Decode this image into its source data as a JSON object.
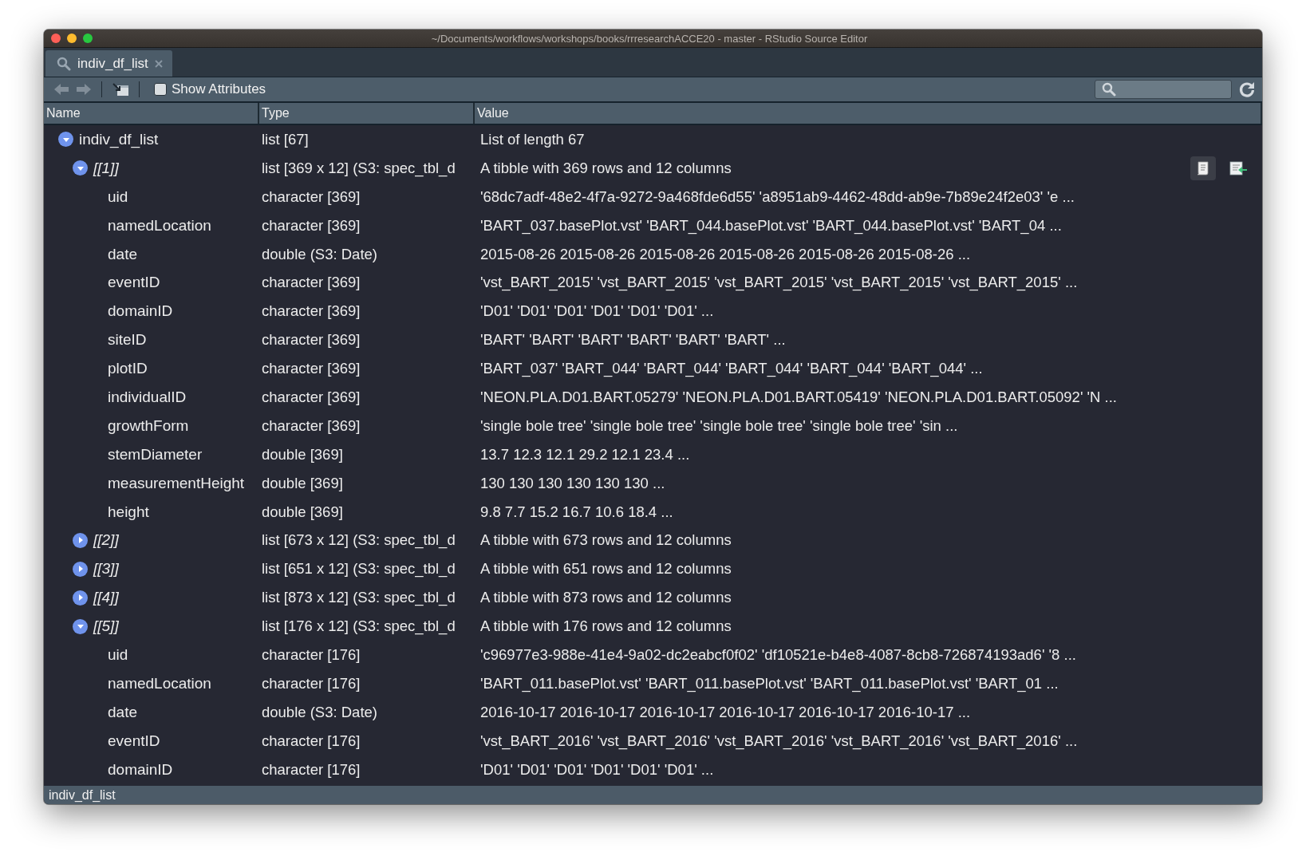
{
  "window": {
    "title": "~/Documents/workflows/workshops/books/rrresearchACCE20 - master - RStudio Source Editor"
  },
  "tabs": [
    {
      "label": "indiv_df_list",
      "selected": true
    }
  ],
  "toolbar": {
    "back_disabled": true,
    "forward_disabled": true,
    "show_attributes": {
      "label": "Show Attributes",
      "checked": false
    }
  },
  "columns": [
    "Name",
    "Type",
    "Value"
  ],
  "tree": [
    {
      "kind": "list",
      "name": "indiv_df_list",
      "type": "list [67]",
      "value": "List of length 67",
      "expanded": true,
      "hovered": false,
      "children": [
        {
          "kind": "element",
          "name": "[[1]]",
          "type": "list [369 x 12] (S3: spec_tbl_d",
          "value": "A tibble with 369 rows and 12 columns",
          "expanded": true,
          "hovered": true,
          "children": [
            {
              "kind": "column",
              "name": "uid",
              "type": "character [369]",
              "value": "'68dc7adf-48e2-4f7a-9272-9a468fde6d55' 'a8951ab9-4462-48dd-ab9e-7b89e24f2e03' 'e ...",
              "hovered": false
            },
            {
              "kind": "column",
              "name": "namedLocation",
              "type": "character [369]",
              "value": "'BART_037.basePlot.vst' 'BART_044.basePlot.vst' 'BART_044.basePlot.vst' 'BART_04 ...",
              "hovered": false
            },
            {
              "kind": "column",
              "name": "date",
              "type": "double (S3: Date)",
              "value": "2015-08-26 2015-08-26 2015-08-26 2015-08-26 2015-08-26 2015-08-26 ...",
              "hovered": false
            },
            {
              "kind": "column",
              "name": "eventID",
              "type": "character [369]",
              "value": "'vst_BART_2015' 'vst_BART_2015' 'vst_BART_2015' 'vst_BART_2015' 'vst_BART_2015' ...",
              "hovered": false
            },
            {
              "kind": "column",
              "name": "domainID",
              "type": "character [369]",
              "value": "'D01' 'D01' 'D01' 'D01' 'D01' 'D01' ...",
              "hovered": false
            },
            {
              "kind": "column",
              "name": "siteID",
              "type": "character [369]",
              "value": "'BART' 'BART' 'BART' 'BART' 'BART' 'BART' ...",
              "hovered": false
            },
            {
              "kind": "column",
              "name": "plotID",
              "type": "character [369]",
              "value": "'BART_037' 'BART_044' 'BART_044' 'BART_044' 'BART_044' 'BART_044' ...",
              "hovered": false
            },
            {
              "kind": "column",
              "name": "individualID",
              "type": "character [369]",
              "value": "'NEON.PLA.D01.BART.05279' 'NEON.PLA.D01.BART.05419' 'NEON.PLA.D01.BART.05092' 'N ...",
              "hovered": false
            },
            {
              "kind": "column",
              "name": "growthForm",
              "type": "character [369]",
              "value": "'single bole tree' 'single bole tree' 'single bole tree' 'single bole tree' 'sin ...",
              "hovered": false
            },
            {
              "kind": "column",
              "name": "stemDiameter",
              "type": "double [369]",
              "value": "13.7 12.3 12.1 29.2 12.1 23.4 ...",
              "hovered": false
            },
            {
              "kind": "column",
              "name": "measurementHeight",
              "type": "double [369]",
              "value": "130 130 130 130 130 130 ...",
              "hovered": false
            },
            {
              "kind": "column",
              "name": "height",
              "type": "double [369]",
              "value": "9.8 7.7 15.2 16.7 10.6 18.4 ...",
              "hovered": false
            }
          ]
        },
        {
          "kind": "element",
          "name": "[[2]]",
          "type": "list [673 x 12] (S3: spec_tbl_d",
          "value": "A tibble with 673 rows and 12 columns",
          "expanded": false,
          "hovered": false
        },
        {
          "kind": "element",
          "name": "[[3]]",
          "type": "list [651 x 12] (S3: spec_tbl_d",
          "value": "A tibble with 651 rows and 12 columns",
          "expanded": false,
          "hovered": false
        },
        {
          "kind": "element",
          "name": "[[4]]",
          "type": "list [873 x 12] (S3: spec_tbl_d",
          "value": "A tibble with 873 rows and 12 columns",
          "expanded": false,
          "hovered": false
        },
        {
          "kind": "element",
          "name": "[[5]]",
          "type": "list [176 x 12] (S3: spec_tbl_d",
          "value": "A tibble with 176 rows and 12 columns",
          "expanded": true,
          "hovered": false,
          "children": [
            {
              "kind": "column",
              "name": "uid",
              "type": "character [176]",
              "value": "'c96977e3-988e-41e4-9a02-dc2eabcf0f02' 'df10521e-b4e8-4087-8cb8-726874193ad6' '8 ...",
              "hovered": false
            },
            {
              "kind": "column",
              "name": "namedLocation",
              "type": "character [176]",
              "value": "'BART_011.basePlot.vst' 'BART_011.basePlot.vst' 'BART_011.basePlot.vst' 'BART_01 ...",
              "hovered": false
            },
            {
              "kind": "column",
              "name": "date",
              "type": "double (S3: Date)",
              "value": "2016-10-17 2016-10-17 2016-10-17 2016-10-17 2016-10-17 2016-10-17 ...",
              "hovered": false
            },
            {
              "kind": "column",
              "name": "eventID",
              "type": "character [176]",
              "value": "'vst_BART_2016' 'vst_BART_2016' 'vst_BART_2016' 'vst_BART_2016' 'vst_BART_2016' ...",
              "hovered": false
            },
            {
              "kind": "column",
              "name": "domainID",
              "type": "character [176]",
              "value": "'D01' 'D01' 'D01' 'D01' 'D01' 'D01' ...",
              "hovered": false
            }
          ]
        }
      ]
    }
  ],
  "status_bar": {
    "text": "indiv_df_list"
  }
}
